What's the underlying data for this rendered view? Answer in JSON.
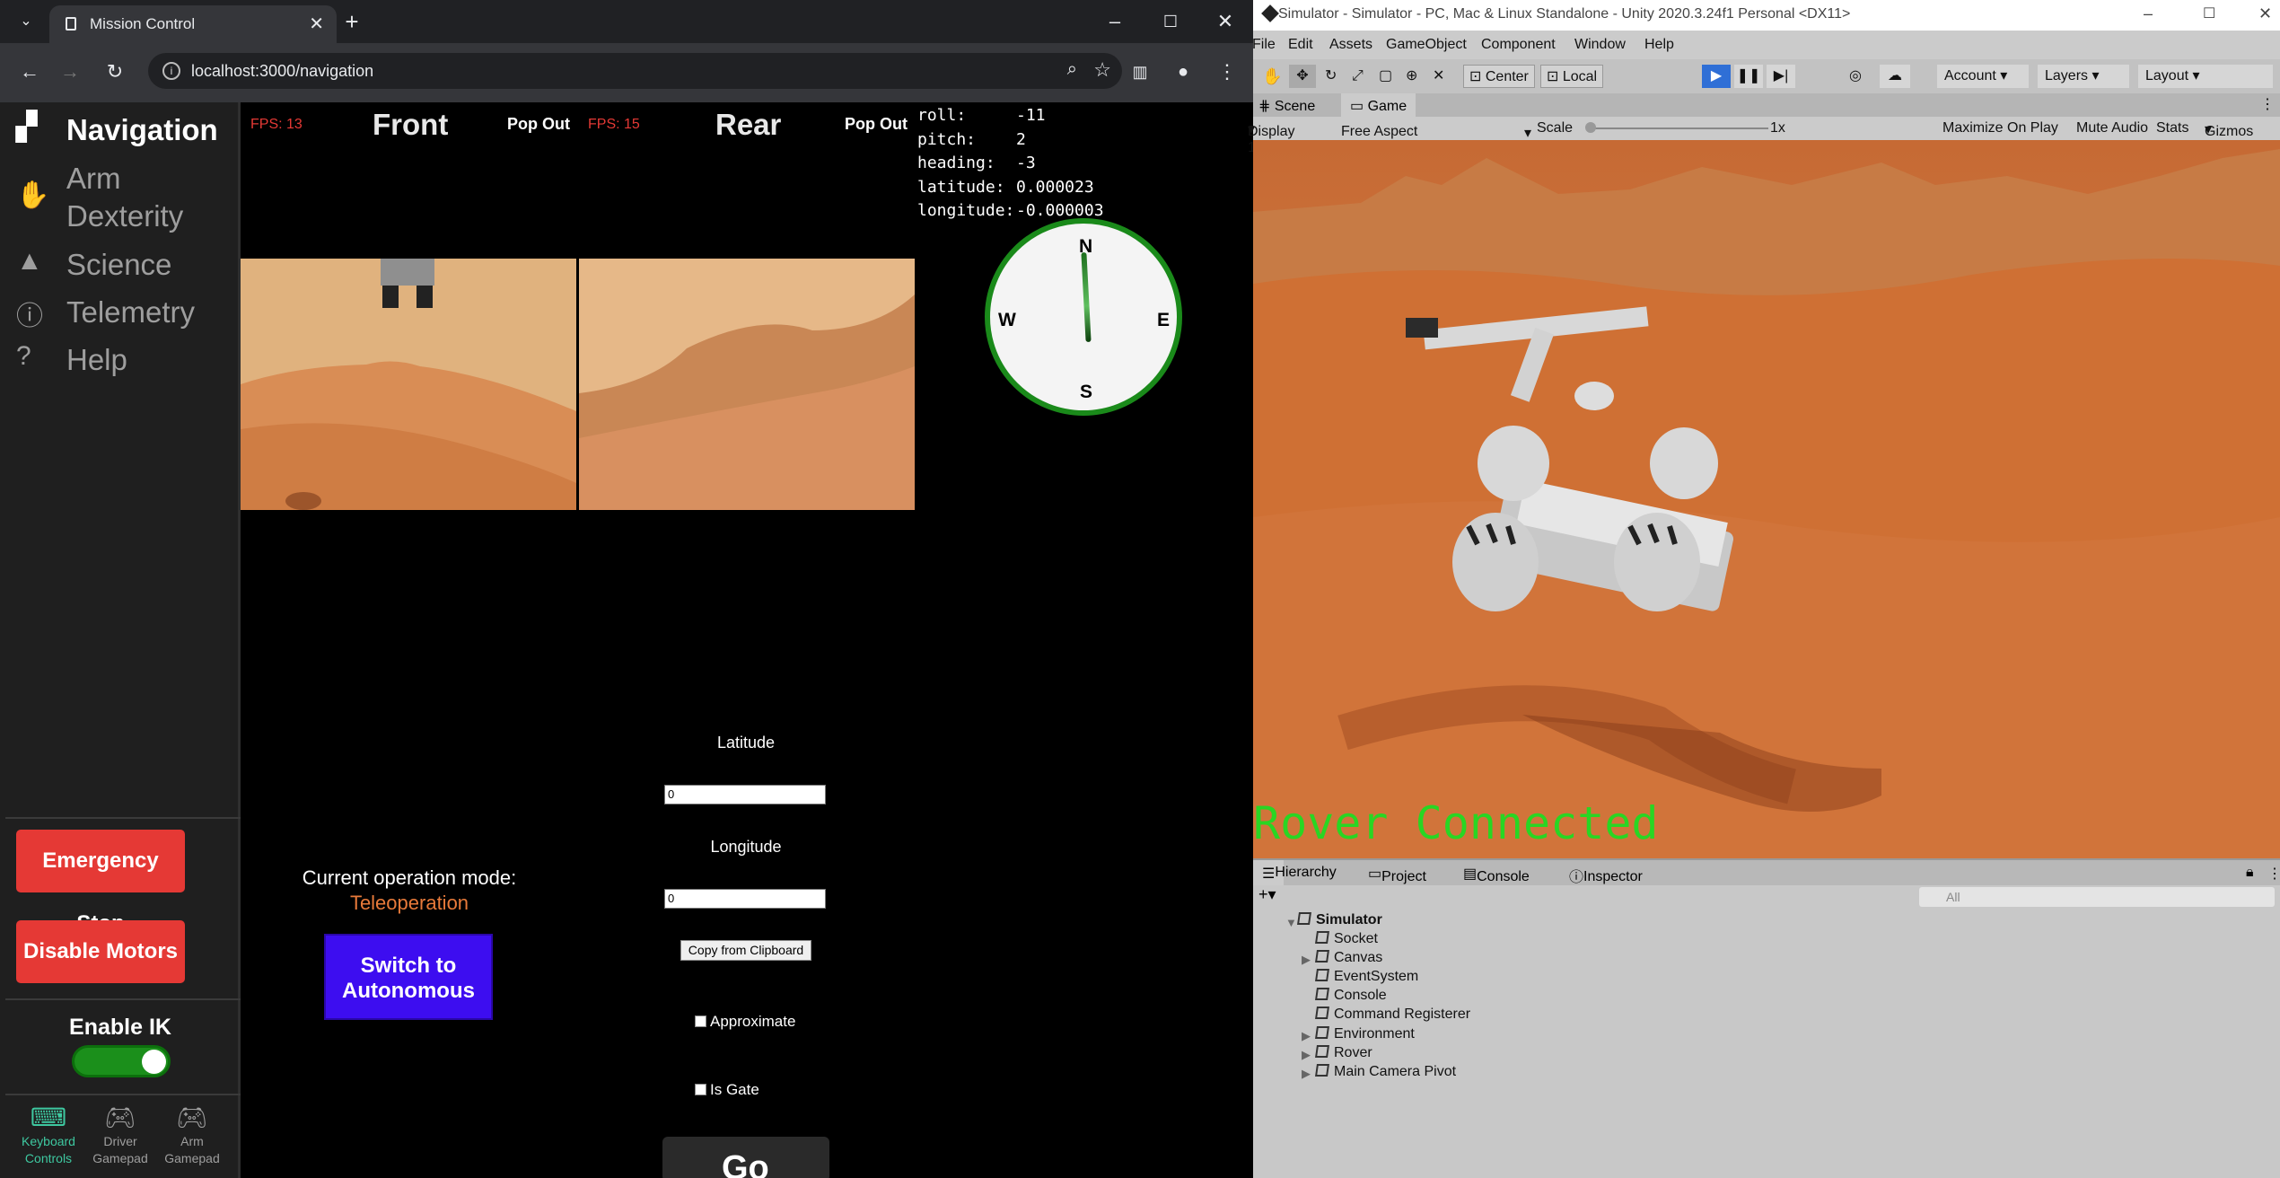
{
  "browser": {
    "tab_title": "Mission Control",
    "url": "localhost:3000/navigation"
  },
  "sidebar": {
    "nav": [
      {
        "label": "Navigation",
        "icon": "map-icon",
        "active": true
      },
      {
        "label": "Arm Dexterity",
        "icon": "hand-icon",
        "active": false
      },
      {
        "label": "Science",
        "icon": "flask-icon",
        "active": false
      },
      {
        "label": "Telemetry",
        "icon": "info-icon",
        "active": false
      },
      {
        "label": "Help",
        "icon": "help-icon",
        "active": false
      }
    ],
    "arm_line1": "Arm",
    "arm_line2": "Dexterity",
    "emergency_stop": "Emergency Stop",
    "disable_motors": "Disable Motors",
    "enable_ik_label": "Enable IK",
    "enable_ik_on": true,
    "controls": [
      {
        "line1": "Keyboard",
        "line2": "Controls",
        "active": true
      },
      {
        "line1": "Driver",
        "line2": "Gamepad",
        "active": false
      },
      {
        "line1": "Arm",
        "line2": "Gamepad",
        "active": false
      }
    ]
  },
  "cameras": {
    "front": {
      "title": "Front",
      "fps": "FPS: 13",
      "pop_out": "Pop Out"
    },
    "rear": {
      "title": "Rear",
      "fps": "FPS: 15",
      "pop_out": "Pop Out"
    }
  },
  "telemetry": {
    "roll_label": "roll:",
    "roll": "-11",
    "pitch_label": "pitch:",
    "pitch": "2",
    "heading_label": "heading:",
    "heading": "-3",
    "latitude_label": "latitude:",
    "latitude": "0.000023",
    "longitude_label": "longitude:",
    "longitude": "-0.000003"
  },
  "compass": {
    "n": "N",
    "s": "S",
    "e": "E",
    "w": "W",
    "heading_deg": -3
  },
  "mode": {
    "label": "Current operation mode:",
    "value": "Teleoperation",
    "value_color": "#e87a3a",
    "switch_line1": "Switch to",
    "switch_line2": "Autonomous"
  },
  "waypoint": {
    "latitude_label": "Latitude",
    "latitude_value": "0",
    "longitude_label": "Longitude",
    "longitude_value": "0",
    "copy_button": "Copy from Clipboard",
    "approximate_label": "Approximate",
    "is_gate_label": "Is Gate",
    "go_button": "Go"
  },
  "unity": {
    "title": "Simulator - Simulator - PC, Mac & Linux Standalone - Unity 2020.3.24f1 Personal <DX11>",
    "menu": [
      "File",
      "Edit",
      "Assets",
      "GameObject",
      "Component",
      "Window",
      "Help"
    ],
    "toolbar": {
      "center": "Center",
      "local": "Local",
      "account": "Account",
      "layers": "Layers",
      "layout": "Layout"
    },
    "tabs": {
      "scene": "Scene",
      "game": "Game"
    },
    "gamebar": {
      "display": "Display 1",
      "aspect": "Free Aspect",
      "scale_label": "Scale",
      "scale_value": "1x",
      "maximize": "Maximize On Play",
      "mute": "Mute Audio",
      "stats": "Stats",
      "gizmos": "Gizmos"
    },
    "status_overlay": "Rover Connected",
    "bottom_tabs": {
      "hierarchy": "Hierarchy",
      "project": "Project",
      "console": "Console",
      "inspector": "Inspector"
    },
    "search_placeholder": "All",
    "hierarchy": {
      "root": "Simulator",
      "items": [
        "Socket",
        "Canvas",
        "EventSystem",
        "Console",
        "Command Registerer",
        "Environment",
        "Rover",
        "Main Camera Pivot"
      ]
    },
    "colors": {
      "overlay_text": "#29d623",
      "play_active": "#2f6fd6"
    }
  }
}
